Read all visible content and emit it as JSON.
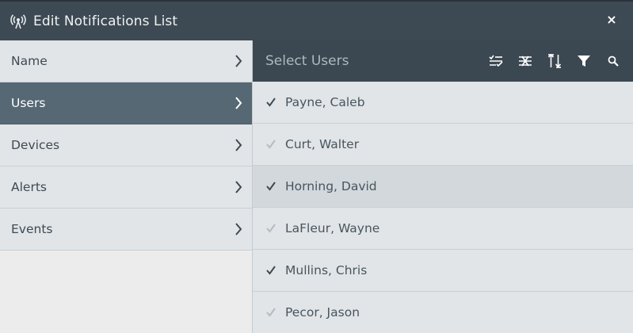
{
  "window": {
    "title": "Edit Notifications List",
    "close_label": "×"
  },
  "sidebar": {
    "items": [
      {
        "label": "Name",
        "active": false
      },
      {
        "label": "Users",
        "active": true
      },
      {
        "label": "Devices",
        "active": false
      },
      {
        "label": "Alerts",
        "active": false
      },
      {
        "label": "Events",
        "active": false
      }
    ]
  },
  "main": {
    "search": {
      "placeholder": "Select Users",
      "value": ""
    },
    "toolbar_icons": [
      "select-all-icon",
      "deselect-all-icon",
      "sort-icon",
      "filter-icon",
      "search-icon"
    ],
    "users": [
      {
        "name": "Payne, Caleb",
        "selected": true
      },
      {
        "name": "Curt, Walter",
        "selected": false
      },
      {
        "name": "Horning, David",
        "selected": true
      },
      {
        "name": "LaFleur, Wayne",
        "selected": false
      },
      {
        "name": "Mullins, Chris",
        "selected": true
      },
      {
        "name": "Pecor, Jason",
        "selected": false
      }
    ]
  },
  "colors": {
    "titlebar": "#3d4a54",
    "active_item": "#566874",
    "check_selected": "#3d4a54",
    "check_unselected": "#b3bcc2"
  }
}
